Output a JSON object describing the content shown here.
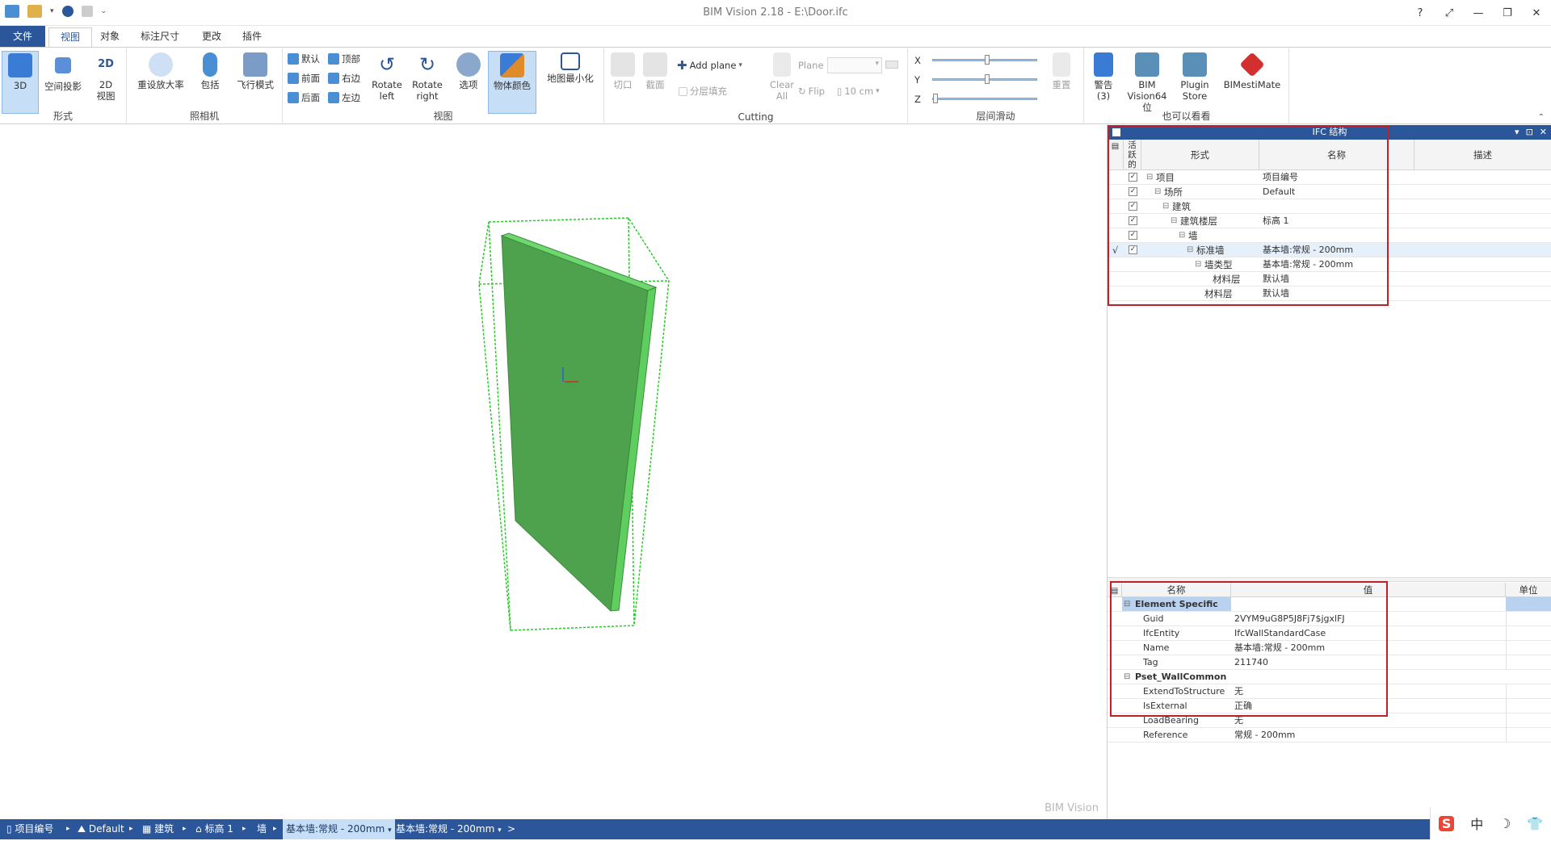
{
  "window": {
    "title": "BIM Vision 2.18 - E:\\Door.ifc",
    "buttons": [
      "?",
      "⤢",
      "—",
      "❐",
      "✕"
    ]
  },
  "tabs": [
    {
      "label": "文件"
    },
    {
      "label": "视图"
    },
    {
      "label": "对象"
    },
    {
      "label": "标注尺寸"
    },
    {
      "label": "更改"
    },
    {
      "label": "插件"
    }
  ],
  "ribbon": {
    "groups": {
      "form": "形式",
      "camera": "照相机",
      "view": "视图",
      "cutting": "Cutting",
      "floors": "层间滑动",
      "also": "也可以看看"
    },
    "form_items": {
      "b3d": "3D",
      "spatial": "空间投影",
      "b2d_line1": "2D",
      "b2d_line2": "视图"
    },
    "camera_items": {
      "zoom": "重设放大率",
      "wrap": "包括",
      "fly": "飞行模式"
    },
    "view_small": {
      "default": "默认",
      "top": "顶部",
      "front": "前面",
      "right": "右边",
      "back": "后面",
      "left": "左边"
    },
    "view_items": {
      "rot_left_1": "Rotate",
      "rot_left_2": "left",
      "rot_right_1": "Rotate",
      "rot_right_2": "right",
      "options": "选项",
      "obj_color": "物体颜色",
      "minimize": "地图最小化"
    },
    "cutting_items": {
      "cut": "切口",
      "section": "截面",
      "add_plane": "Add plane",
      "layer_fill": "分层填充",
      "clear_1": "Clear",
      "clear_2": "All",
      "plane_label": "Plane",
      "flip": "Flip",
      "thickness": "10 cm"
    },
    "floors_items": {
      "x": "X",
      "y": "Y",
      "z": "Z",
      "reset": "重置"
    },
    "also_items": {
      "warn_1": "警告",
      "warn_2": "(3)",
      "bimv_1": "BIM",
      "bimv_2": "Vision64位",
      "store_1": "Plugin",
      "store_2": "Store",
      "mestimate": "BIMestiMate"
    }
  },
  "viewport": {
    "watermark": "BIM Vision"
  },
  "ifc_panel": {
    "title": "IFC 结构",
    "headers": {
      "active_1": "活",
      "active_2": "跃",
      "active_3": "的",
      "form": "形式",
      "name": "名称",
      "desc": "描述"
    },
    "rows": [
      {
        "form": "项目",
        "name": "项目编号",
        "level": 0,
        "expander": true
      },
      {
        "form": "场所",
        "name": "Default",
        "level": 1,
        "expander": true
      },
      {
        "form": "建筑",
        "name": "",
        "level": 2,
        "expander": true
      },
      {
        "form": "建筑楼层",
        "name": "标高 1",
        "level": 3,
        "expander": true
      },
      {
        "form": "墙",
        "name": "",
        "level": 4,
        "expander": true
      },
      {
        "form": "标准墙",
        "name": "基本墙:常规 - 200mm",
        "level": 5,
        "expander": true,
        "selected": true
      },
      {
        "form": "墙类型",
        "name": "基本墙:常规 - 200mm",
        "level": 6,
        "expander": true
      },
      {
        "form": "材料层",
        "name": "默认墙",
        "level": 7,
        "expander": false
      },
      {
        "form": "材料层",
        "name": "默认墙",
        "level": 6,
        "expander": false
      }
    ],
    "selected_mark": "√"
  },
  "props_panel": {
    "headers": {
      "name": "名称",
      "value": "值",
      "unit": "单位"
    },
    "groups": [
      {
        "title": "Element Specific",
        "items": [
          {
            "name": "Guid",
            "value": "2VYM9uG8P5J8Fj7$jgxlFJ"
          },
          {
            "name": "IfcEntity",
            "value": "IfcWallStandardCase"
          },
          {
            "name": "Name",
            "value": "基本墙:常规 - 200mm"
          },
          {
            "name": "Tag",
            "value": "211740"
          }
        ]
      },
      {
        "title": "Pset_WallCommon",
        "items": [
          {
            "name": "ExtendToStructure",
            "value": "无"
          },
          {
            "name": "IsExternal",
            "value": "正确"
          },
          {
            "name": "LoadBearing",
            "value": "无"
          },
          {
            "name": "Reference",
            "value": "常规 - 200mm"
          }
        ]
      }
    ]
  },
  "statusbar": {
    "items": [
      "项目编号",
      "Default",
      "建筑",
      "标高 1",
      "墙",
      "基本墙:常规 - 200mm",
      "基本墙:常规 - 200mm",
      ">"
    ]
  },
  "tray": {
    "ime_1": "S",
    "ime_2": "中",
    "moon": "☽",
    "shirt": "👕"
  },
  "colors": {
    "accent": "#2b579a",
    "wall": "#4ea24e",
    "bbox": "#22cc22",
    "highlight_box": "#c0202a"
  }
}
